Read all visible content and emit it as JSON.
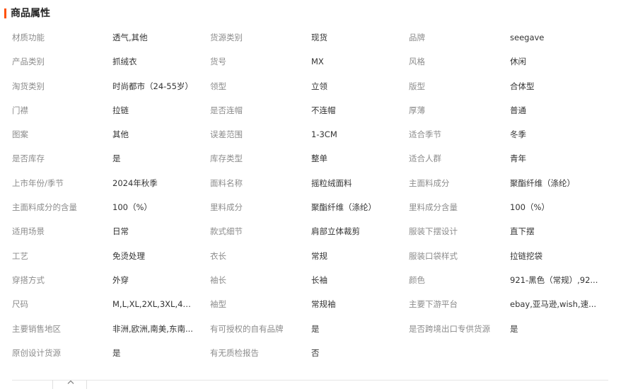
{
  "section": {
    "title": "商品属性",
    "accent_color": "#ff5000"
  },
  "rows": [
    [
      {
        "label": "材质功能",
        "value": "透气,其他"
      },
      {
        "label": "货源类别",
        "value": "现货"
      },
      {
        "label": "品牌",
        "value": "seegave"
      }
    ],
    [
      {
        "label": "产品类别",
        "value": "抓绒衣"
      },
      {
        "label": "货号",
        "value": "MX"
      },
      {
        "label": "风格",
        "value": "休闲"
      }
    ],
    [
      {
        "label": "淘货类别",
        "value": "时尚都市（24-55岁）"
      },
      {
        "label": "领型",
        "value": "立领"
      },
      {
        "label": "版型",
        "value": "合体型"
      }
    ],
    [
      {
        "label": "门襟",
        "value": "拉链"
      },
      {
        "label": "是否连帽",
        "value": "不连帽"
      },
      {
        "label": "厚薄",
        "value": "普通"
      }
    ],
    [
      {
        "label": "图案",
        "value": "其他"
      },
      {
        "label": "误差范围",
        "value": "1-3CM"
      },
      {
        "label": "适合季节",
        "value": "冬季"
      }
    ],
    [
      {
        "label": "是否库存",
        "value": "是"
      },
      {
        "label": "库存类型",
        "value": "整单"
      },
      {
        "label": "适合人群",
        "value": "青年"
      }
    ],
    [
      {
        "label": "上市年份/季节",
        "value": "2024年秋季"
      },
      {
        "label": "面料名称",
        "value": "摇粒绒面料"
      },
      {
        "label": "主面料成分",
        "value": "聚酯纤维（涤纶）"
      }
    ],
    [
      {
        "label": "主面料成分的含量",
        "value": "100（%）"
      },
      {
        "label": "里料成分",
        "value": "聚酯纤维（涤纶）"
      },
      {
        "label": "里料成分含量",
        "value": "100（%）"
      }
    ],
    [
      {
        "label": "适用场景",
        "value": "日常"
      },
      {
        "label": "款式细节",
        "value": "肩部立体裁剪"
      },
      {
        "label": "服装下摆设计",
        "value": "直下摆"
      }
    ],
    [
      {
        "label": "工艺",
        "value": "免烫处理"
      },
      {
        "label": "衣长",
        "value": "常规"
      },
      {
        "label": "服装口袋样式",
        "value": "拉链挖袋"
      }
    ],
    [
      {
        "label": "穿搭方式",
        "value": "外穿"
      },
      {
        "label": "袖长",
        "value": "长袖"
      },
      {
        "label": "颜色",
        "value": "921-黑色（常规）,92..."
      }
    ],
    [
      {
        "label": "尺码",
        "value": "M,L,XL,2XL,3XL,4XL,5..."
      },
      {
        "label": "袖型",
        "value": "常规袖"
      },
      {
        "label": "主要下游平台",
        "value": "ebay,亚马逊,wish,速..."
      }
    ],
    [
      {
        "label": "主要销售地区",
        "value": "非洲,欧洲,南美,东南..."
      },
      {
        "label": "有可授权的自有品牌",
        "value": "是"
      },
      {
        "label": "是否跨境出口专供货源",
        "value": "是"
      }
    ],
    [
      {
        "label": "原创设计货源",
        "value": "是"
      },
      {
        "label": "有无质检报告",
        "value": "否"
      },
      {
        "label": "",
        "value": ""
      }
    ]
  ],
  "footer": {
    "toggle_icon": "chevron-up-icon"
  }
}
